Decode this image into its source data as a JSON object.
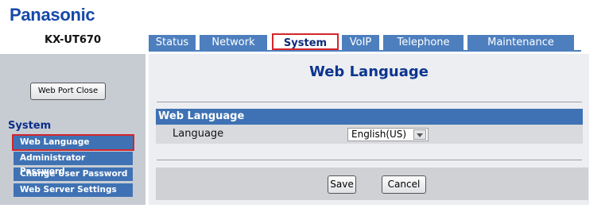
{
  "brand": {
    "logo": "Panasonic",
    "model": "KX-UT670"
  },
  "tabs": [
    {
      "label": "Status",
      "active": false
    },
    {
      "label": "Network",
      "active": false
    },
    {
      "label": "System",
      "active": true
    },
    {
      "label": "VoIP",
      "active": false
    },
    {
      "label": "Telephone",
      "active": false
    },
    {
      "label": "Maintenance",
      "active": false
    }
  ],
  "sidebar": {
    "web_port_close_label": "Web Port Close",
    "section_title": "System",
    "items": [
      {
        "label": "Web Language",
        "active": true
      },
      {
        "label": "Administrator Password",
        "active": false
      },
      {
        "label": "Change User Password",
        "active": false
      },
      {
        "label": "Web Server Settings",
        "active": false
      }
    ]
  },
  "main": {
    "title": "Web Language",
    "section_title": "Web Language",
    "language_label": "Language",
    "language_value": "English(US)",
    "save_label": "Save",
    "cancel_label": "Cancel"
  },
  "colors": {
    "brand_blue": "#1548a8",
    "tab_blue": "#4d7fbf",
    "highlight_red": "#d4252c",
    "sidebar_bg": "#c7ccd3"
  }
}
